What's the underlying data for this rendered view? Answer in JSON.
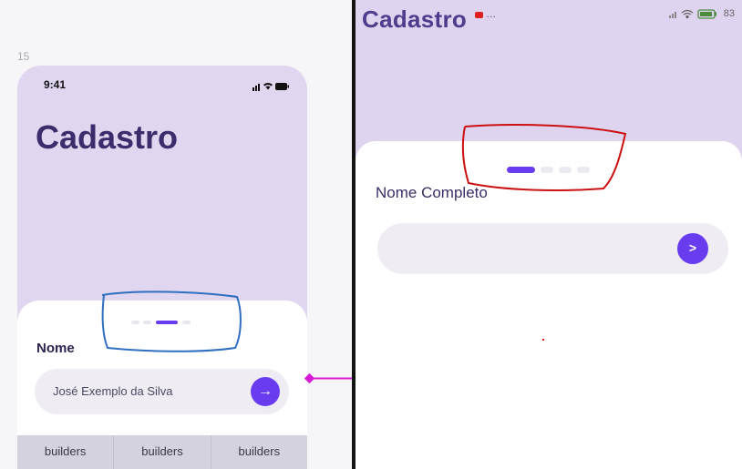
{
  "left": {
    "frame_number": "15",
    "time": "9:41",
    "title": "Cadastro",
    "label": "Nome",
    "input_value": "José Exemplo da Silva",
    "next_glyph": "→",
    "footer": [
      "builders",
      "builders",
      "builders"
    ]
  },
  "right": {
    "title": "Cadastro",
    "status_left": "…",
    "status_right": "83",
    "label": "Nome Completo",
    "next_glyph": ">"
  },
  "colors": {
    "accent": "#6a3cf0",
    "hero_bg": "#e1d6ef",
    "title": "#3c2c6c",
    "annotation_blue": "#2f6fc0",
    "annotation_red": "#cc1111",
    "connector": "#d61ad6"
  },
  "steps": {
    "total": 4,
    "left_active_index": 2,
    "right_active_index": 0
  }
}
